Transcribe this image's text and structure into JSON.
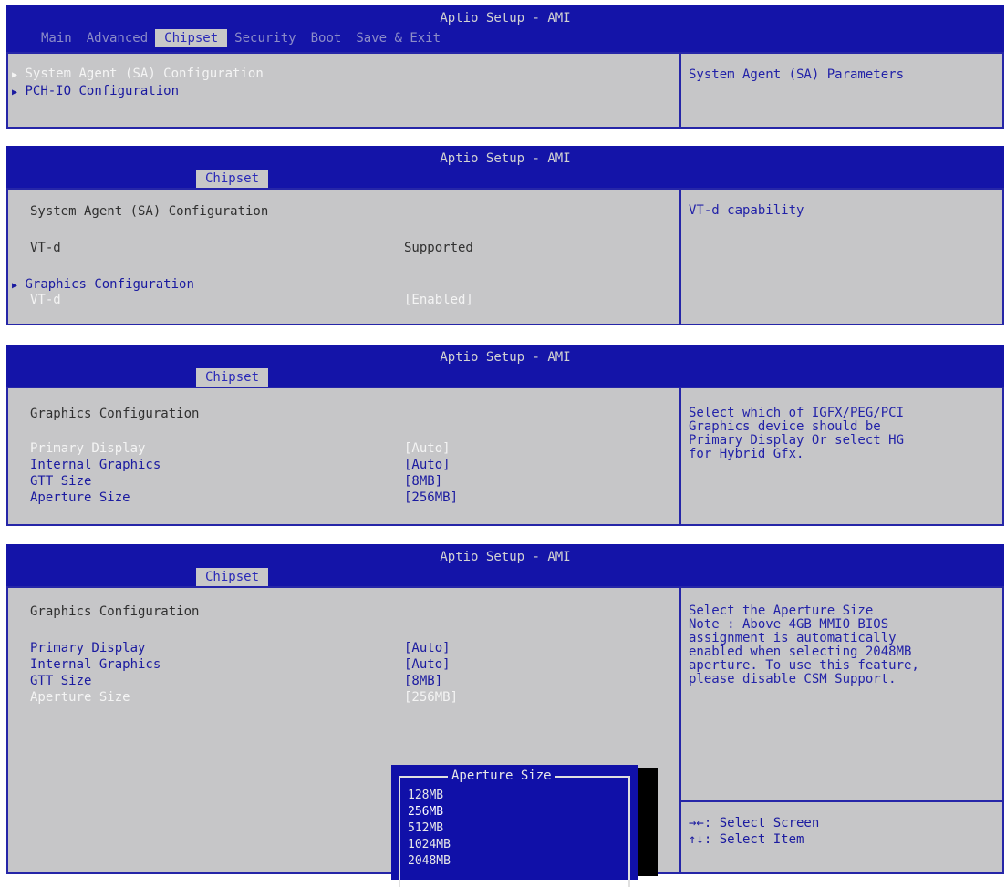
{
  "screens": [
    {
      "title": "Aptio Setup - AMI",
      "tabs": [
        "Main",
        "Advanced",
        "Chipset",
        "Security",
        "Boot",
        "Save & Exit"
      ],
      "active_tab": "Chipset",
      "items": [
        {
          "marker": "▶",
          "label": "System Agent (SA) Configuration"
        },
        {
          "marker": "▶",
          "label": "PCH-IO Configuration"
        }
      ],
      "help": "System Agent (SA) Parameters"
    },
    {
      "title": "Aptio Setup - AMI",
      "active_tab": "Chipset",
      "section_title": "System Agent (SA) Configuration",
      "info_label": "VT-d",
      "info_value": "Supported",
      "submenu_marker": "▶",
      "submenu_label": "Graphics Configuration",
      "setting_label": "VT-d",
      "setting_value": "[Enabled]",
      "help": "VT-d capability"
    },
    {
      "title": "Aptio Setup - AMI",
      "active_tab": "Chipset",
      "section_title": "Graphics Configuration",
      "settings": [
        {
          "label": "Primary Display",
          "value": "[Auto]"
        },
        {
          "label": "Internal Graphics",
          "value": "[Auto]"
        },
        {
          "label": "GTT Size",
          "value": "[8MB]"
        },
        {
          "label": "Aperture Size",
          "value": "[256MB]"
        }
      ],
      "help": "Select which of IGFX/PEG/PCI\nGraphics device should be\nPrimary Display Or select HG\nfor Hybrid Gfx."
    },
    {
      "title": "Aptio Setup - AMI",
      "active_tab": "Chipset",
      "section_title": "Graphics Configuration",
      "settings": [
        {
          "label": "Primary Display",
          "value": "[Auto]"
        },
        {
          "label": "Internal Graphics",
          "value": "[Auto]"
        },
        {
          "label": "GTT Size",
          "value": "[8MB]"
        },
        {
          "label": "Aperture Size",
          "value": "[256MB]"
        }
      ],
      "help": "Select the Aperture Size\nNote : Above 4GB MMIO BIOS\nassignment is automatically\nenabled when selecting 2048MB\naperture. To use this feature,\nplease disable CSM Support.",
      "keys": [
        {
          "key": "→←",
          "desc": ": Select Screen"
        },
        {
          "key": "↑↓",
          "desc": ": Select Item"
        }
      ],
      "popup": {
        "title": "Aperture Size",
        "options": [
          "128MB",
          "256MB",
          "512MB",
          "1024MB",
          "2048MB"
        ]
      }
    }
  ],
  "colors": {
    "header_blue": "#1414a8",
    "panel_gray": "#c6c6c8",
    "text_blue": "#1a1aa0",
    "highlight_white": "#f4f4f4"
  }
}
